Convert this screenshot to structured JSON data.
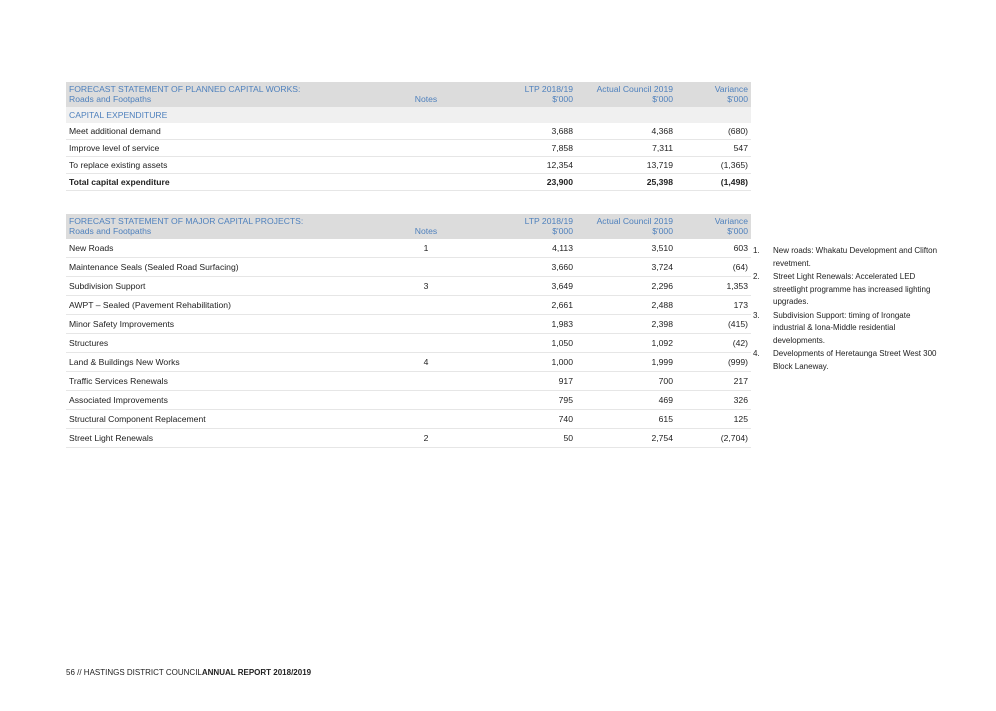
{
  "table1": {
    "title_line1": "FORECAST STATEMENT OF PLANNED CAPITAL WORKS:",
    "title_line2": "Roads and Footpaths",
    "notes_header": "Notes",
    "col_ltp_line1": "LTP 2018/19",
    "col_ltp_line2": "$'000",
    "col_actual_line1": "Actual Council 2019",
    "col_actual_line2": "$'000",
    "col_variance_line1": "Variance",
    "col_variance_line2": "$'000",
    "section_label": "CAPITAL EXPENDITURE",
    "rows": [
      {
        "label": "Meet additional demand",
        "note": "",
        "ltp": "3,688",
        "actual": "4,368",
        "variance": "(680)"
      },
      {
        "label": "Improve level of service",
        "note": "",
        "ltp": "7,858",
        "actual": "7,311",
        "variance": "547"
      },
      {
        "label": "To replace existing assets",
        "note": "",
        "ltp": "12,354",
        "actual": "13,719",
        "variance": "(1,365)"
      },
      {
        "label": "Total capital expenditure",
        "note": "",
        "ltp": "23,900",
        "actual": "25,398",
        "variance": "(1,498)"
      }
    ]
  },
  "table2": {
    "title_line1": "FORECAST STATEMENT OF MAJOR CAPITAL PROJECTS:",
    "title_line2": "Roads and Footpaths",
    "notes_header": "Notes",
    "col_ltp_line1": "LTP 2018/19",
    "col_ltp_line2": "$'000",
    "col_actual_line1": "Actual Council 2019",
    "col_actual_line2": "$'000",
    "col_variance_line1": "Variance",
    "col_variance_line2": "$'000",
    "rows": [
      {
        "label": "New Roads",
        "note": "1",
        "ltp": "4,113",
        "actual": "3,510",
        "variance": "603"
      },
      {
        "label": "Maintenance Seals (Sealed Road Surfacing)",
        "note": "",
        "ltp": "3,660",
        "actual": "3,724",
        "variance": "(64)"
      },
      {
        "label": "Subdivision Support",
        "note": "3",
        "ltp": "3,649",
        "actual": "2,296",
        "variance": "1,353"
      },
      {
        "label": "AWPT – Sealed (Pavement Rehabilitation)",
        "note": "",
        "ltp": "2,661",
        "actual": "2,488",
        "variance": "173"
      },
      {
        "label": "Minor Safety Improvements",
        "note": "",
        "ltp": "1,983",
        "actual": "2,398",
        "variance": "(415)"
      },
      {
        "label": "Structures",
        "note": "",
        "ltp": "1,050",
        "actual": "1,092",
        "variance": "(42)"
      },
      {
        "label": "Land & Buildings New Works",
        "note": "4",
        "ltp": "1,000",
        "actual": "1,999",
        "variance": "(999)"
      },
      {
        "label": "Traffic Services Renewals",
        "note": "",
        "ltp": "917",
        "actual": "700",
        "variance": "217"
      },
      {
        "label": "Associated Improvements",
        "note": "",
        "ltp": "795",
        "actual": "469",
        "variance": "326"
      },
      {
        "label": "Structural Component Replacement",
        "note": "",
        "ltp": "740",
        "actual": "615",
        "variance": "125"
      },
      {
        "label": "Street Light Renewals",
        "note": "2",
        "ltp": "50",
        "actual": "2,754",
        "variance": "(2,704)"
      }
    ]
  },
  "notes": [
    {
      "num": "1.",
      "text": "New roads: Whakatu Development and Clifton revetment."
    },
    {
      "num": "2.",
      "text": "Street Light Renewals: Accelerated LED streetlight programme has increased lighting upgrades."
    },
    {
      "num": "3.",
      "text": "Subdivision Support: timing of Irongate industrial & Iona-Middle residential developments."
    },
    {
      "num": "4.",
      "text": "Developments of Heretaunga Street West 300 Block Laneway."
    }
  ],
  "footer": {
    "prefix": "56 // HASTINGS DISTRICT COUNCIL",
    "bold": "ANNUAL REPORT 2018/2019"
  }
}
